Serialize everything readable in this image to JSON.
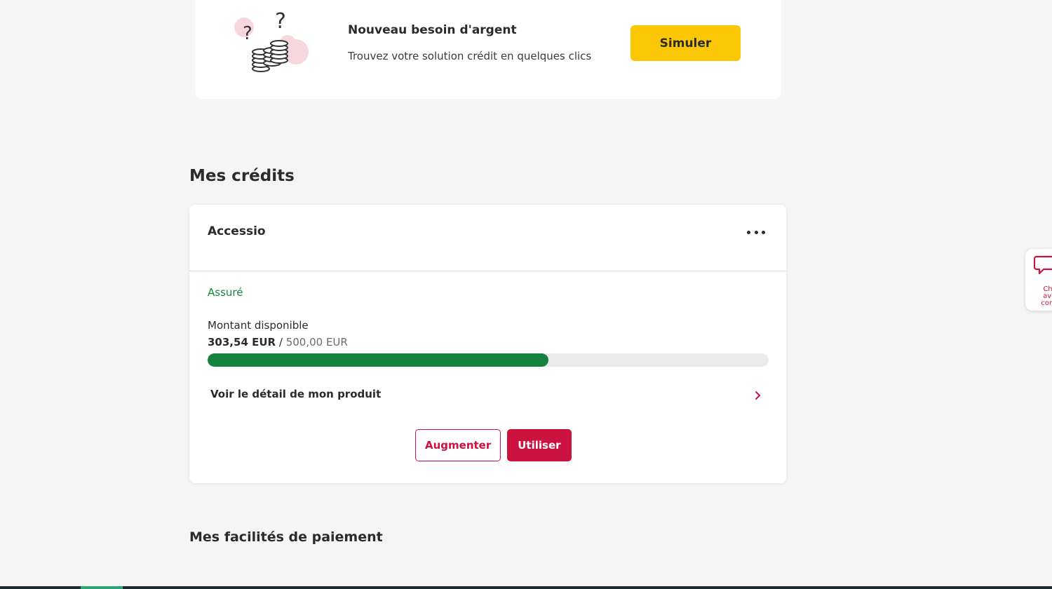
{
  "promo": {
    "title": "Nouveau besoin d'argent",
    "subtitle": "Trouvez votre solution crédit en quelques clics",
    "cta_label": "Simuler",
    "illustration_icon": "coins-question-icon"
  },
  "credits_section": {
    "title": "Mes crédits"
  },
  "credit_card": {
    "name": "Accessio",
    "more_icon": "more-horizontal-icon",
    "insured_label": "Assuré",
    "available_label": "Montant disponible",
    "amount_current": "303,54 EUR",
    "amount_separator": " / ",
    "amount_total": "500,00 EUR",
    "progress_fraction": 0.6071,
    "detail_link_label": "Voir le détail de mon produit",
    "detail_icon": "chevron-right-icon",
    "increase_label": "Augmenter",
    "use_label": "Utiliser"
  },
  "payment_section": {
    "title": "Mes facilités de paiement"
  },
  "chat_widget": {
    "icon": "chat-bubble-icon",
    "line1": "Chat",
    "line2": "avec",
    "line3": "conse"
  },
  "colors": {
    "accent_red": "#cc1340",
    "accent_yellow": "#fbc603",
    "success_green": "#14813c",
    "background": "#f5f5f5"
  }
}
